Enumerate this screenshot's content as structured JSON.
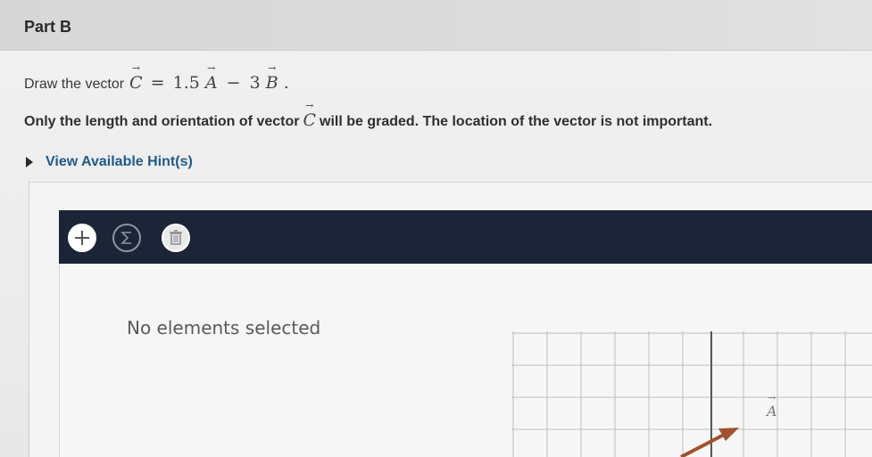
{
  "part": {
    "title": "Part B"
  },
  "prompt": {
    "text": "Draw the vector",
    "equation": {
      "lhs": "C",
      "equals": "=",
      "coef_a": "1.5",
      "var_a": "A",
      "minus": "−",
      "coef_b": "3",
      "var_b": "B",
      "end": "."
    }
  },
  "note": {
    "before": "Only the length and orientation of vector",
    "vector": "C",
    "after": "will be graded. The location of the vector is not important."
  },
  "hints": {
    "label": "View Available Hint(s)"
  },
  "toolbar": {
    "add_icon": "plus-icon",
    "sum_icon": "sigma-icon",
    "delete_icon": "trash-icon"
  },
  "canvas": {
    "status_text": "No elements selected",
    "vector_label": "A",
    "vector_color": "#a0522d"
  },
  "colors": {
    "toolbar_bg": "#1c2437",
    "hint_link": "#1f5a8a"
  }
}
